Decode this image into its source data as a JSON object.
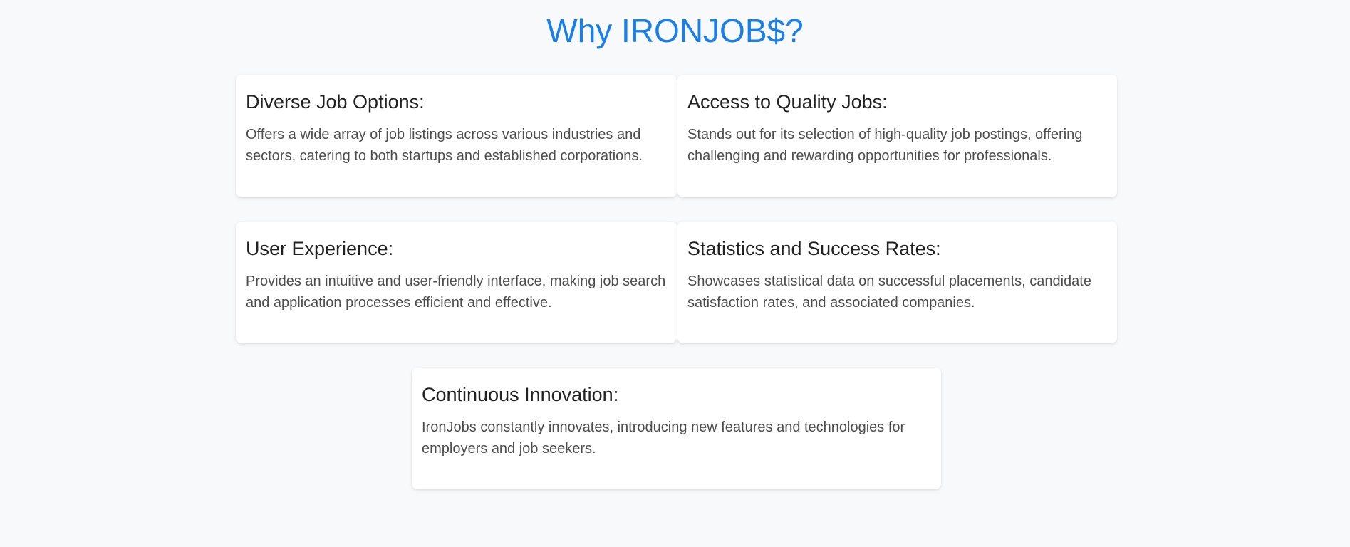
{
  "header": {
    "title": "Why IRONJOB$?",
    "accent_color": "#1a7fe8"
  },
  "features": [
    {
      "title": "Diverse Job Options:",
      "description": "Offers a wide array of job listings across various industries and sectors, catering to both startups and established corporations."
    },
    {
      "title": "Access to Quality Jobs:",
      "description": "Stands out for its selection of high-quality job postings, offering challenging and rewarding opportunities for professionals."
    },
    {
      "title": "User Experience:",
      "description": "Provides an intuitive and user-friendly interface, making job search and application processes efficient and effective."
    },
    {
      "title": "Statistics and Success Rates:",
      "description": "Showcases statistical data on successful placements, candidate satisfaction rates, and associated companies."
    },
    {
      "title": "Continuous Innovation:",
      "description": "IronJobs constantly innovates, introducing new features and technologies for employers and job seekers."
    }
  ]
}
